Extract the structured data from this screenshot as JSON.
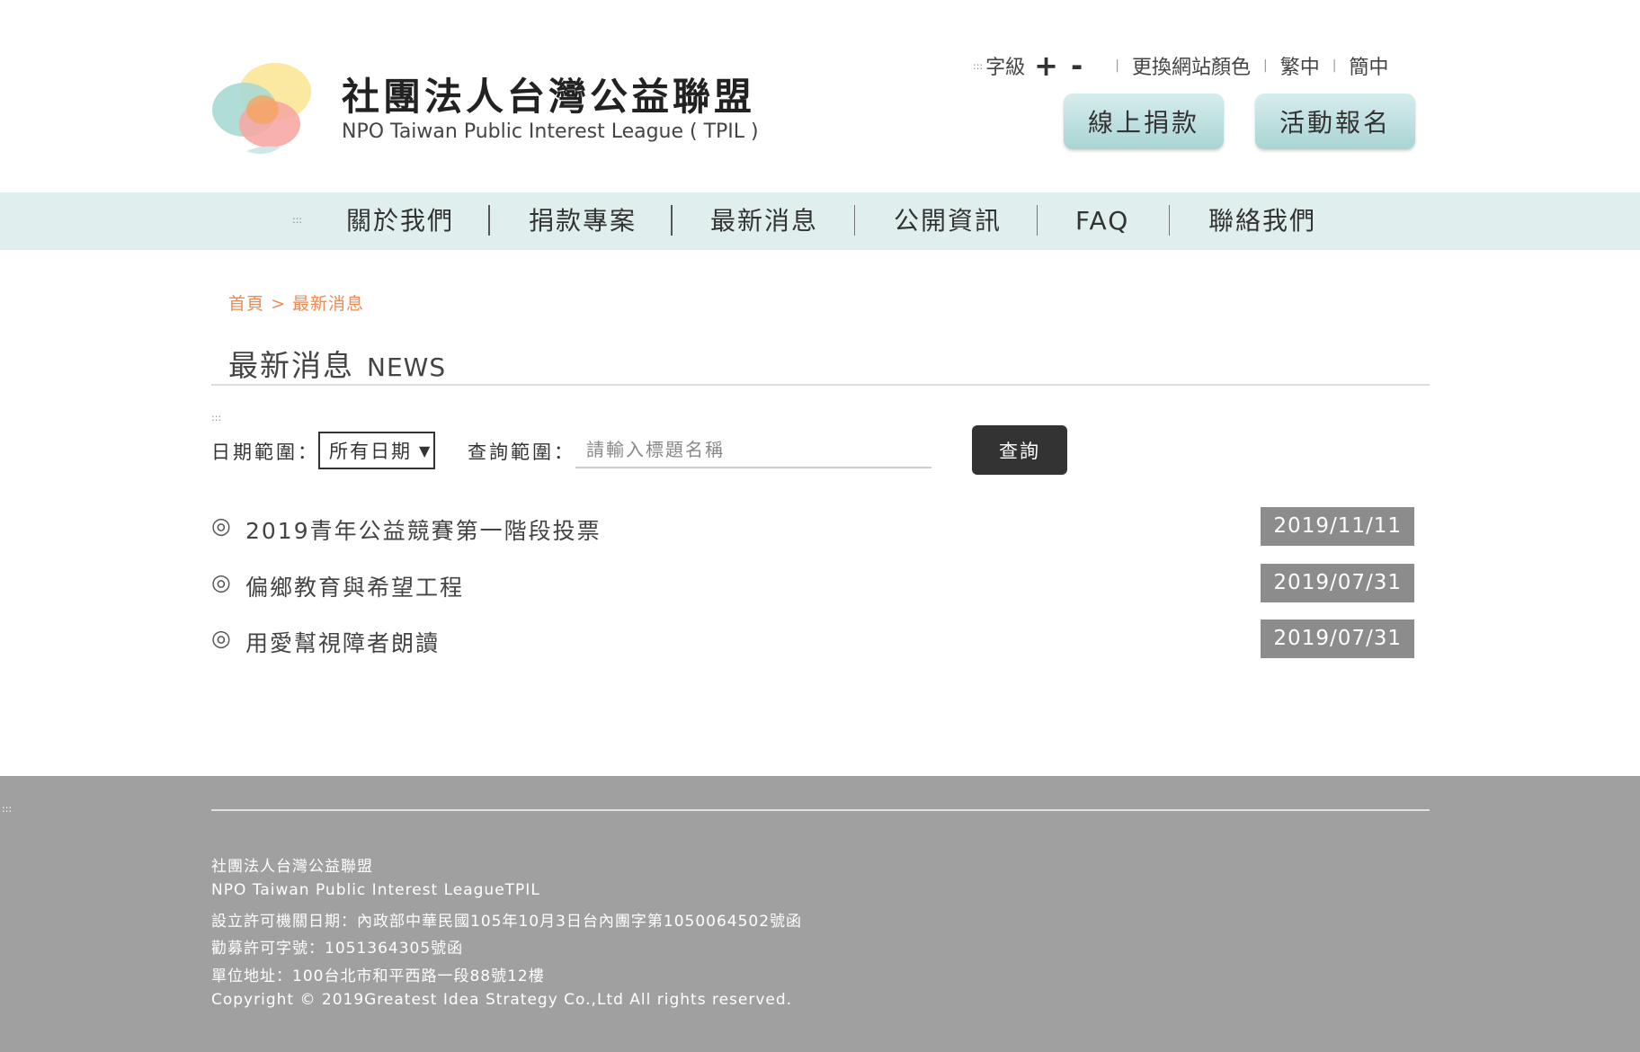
{
  "header": {
    "org_name_cn": "社團法人台灣公益聯盟",
    "org_name_en": "NPO Taiwan Public Interest League ( TPIL )",
    "accesskey_marker": ":::",
    "font_size_label": "字級",
    "font_increase": "+",
    "font_decrease": "-",
    "separator": "|",
    "change_color_label": "更換網站顏色",
    "traditional_label": "繁中",
    "simplified_label": "簡中",
    "donate_button": "線上捐款",
    "signup_button": "活動報名",
    "button_color": "#a9d4d3"
  },
  "nav": {
    "accesskey_marker": ":::",
    "background": "#e0eeee",
    "items": [
      {
        "label": "關於我們"
      },
      {
        "label": "捐款專案"
      },
      {
        "label": "最新消息"
      },
      {
        "label": "公開資訊"
      },
      {
        "label": "FAQ"
      },
      {
        "label": "聯絡我們"
      }
    ]
  },
  "breadcrumb": {
    "home": "首頁",
    "separator": ">",
    "current": "最新消息",
    "color": "#f08a52"
  },
  "page": {
    "title_cn": "最新消息",
    "title_en": "NEWS"
  },
  "search": {
    "accesskey_marker": ":::",
    "date_label": "日期範圍：",
    "date_selected": "所有日期",
    "date_arrow": "▼",
    "keyword_label": "查詢範圍：",
    "keyword_placeholder": "請輸入標題名稱",
    "keyword_value": "",
    "submit_label": "查詢"
  },
  "news": {
    "bullet": "◎",
    "items": [
      {
        "title": "2019青年公益競賽第一階段投票",
        "date": "2019/11/11"
      },
      {
        "title": "偏鄉教育與希望工程",
        "date": "2019/07/31"
      },
      {
        "title": "用愛幫視障者朗讀",
        "date": "2019/07/31"
      }
    ]
  },
  "footer": {
    "accesskey_marker": ":::",
    "background": "#a0a0a0",
    "org_name_cn": "社團法人台灣公益聯盟",
    "org_name_en": "NPO Taiwan Public Interest LeagueTPIL",
    "approval": "設立許可機關日期：內政部中華民國105年10月3日台內團字第1050064502號函",
    "fundraising_permit": "勸募許可字號：1051364305號函",
    "address": "單位地址：100台北市和平西路一段88號12樓",
    "copyright": "Copyright © 2019Greatest Idea Strategy Co.,Ltd All rights reserved."
  }
}
